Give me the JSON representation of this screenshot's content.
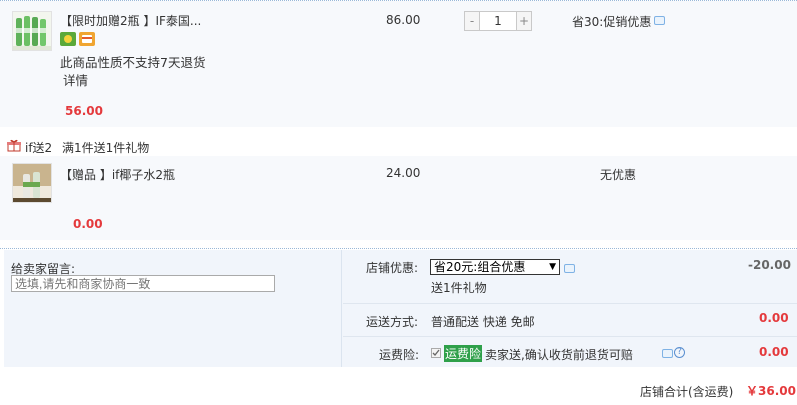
{
  "item1": {
    "title": "【限时加赠2瓶 】IF泰国...",
    "notice": "此商品性质不支持7天退货",
    "detail_link": "详情",
    "unit_price": "86.00",
    "quantity": "1",
    "discount_text": "省30:促销优惠",
    "subtotal": "56.00"
  },
  "gift_promo": {
    "tag": "if送2",
    "desc": "满1件送1件礼物"
  },
  "item2": {
    "title": "【赠品 】if椰子水2瓶",
    "unit_price": "24.00",
    "discount_text": "无优惠",
    "subtotal": "0.00"
  },
  "seller_message": {
    "label": "给卖家留言:",
    "placeholder": "选填,请先和商家协商一致"
  },
  "shop_discount": {
    "label": "店铺优惠:",
    "selected": "省20元:组合优惠",
    "gift_note": "送1件礼物",
    "amount": "-20.00"
  },
  "shipping": {
    "label": "运送方式:",
    "value": "普通配送 快递 免邮",
    "amount": "0.00"
  },
  "insurance": {
    "label": "运费险:",
    "tag": "运费险",
    "desc": "卖家送,确认收货前退货可赔",
    "amount": "0.00",
    "checked": true
  },
  "total": {
    "label": "店铺合计(含运费)",
    "amount": "￥36.00"
  },
  "colors": {
    "price_red": "#e4393c",
    "panel_bg": "#f1f5fb",
    "insurance_green": "#2fa04a"
  },
  "icons": [
    "gift-icon",
    "chat-icon",
    "help-icon",
    "checkbox-icon",
    "dropdown-arrow-icon"
  ]
}
